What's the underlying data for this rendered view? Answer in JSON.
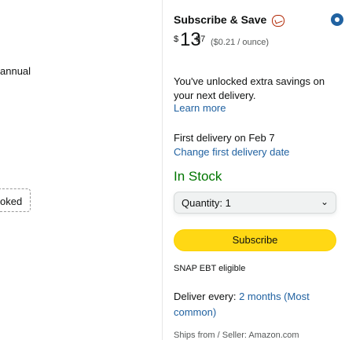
{
  "left_column": {
    "annual_text": "annual",
    "booked_text": "oked"
  },
  "subscribe": {
    "title": "Subscribe & Save",
    "badge_icon": "subscribe-save-icon",
    "radio_selected": true
  },
  "price": {
    "symbol": "$",
    "whole": "13",
    "fraction": "97",
    "per_unit": "($0.21 / ounce)"
  },
  "savings_message": "You've unlocked extra savings on your next delivery.",
  "learn_more": "Learn more",
  "first_delivery": "First delivery on Feb 7",
  "change_date": "Change first delivery date",
  "in_stock": "In Stock",
  "quantity": {
    "label": "Quantity: 1",
    "chevron_icon": "chevron-down-icon"
  },
  "subscribe_button": "Subscribe",
  "snap": "SNAP EBT eligible",
  "deliver_every": {
    "prefix": "Deliver every:",
    "value": "2 months (Most common)"
  },
  "ships_from": "Ships from / Seller: Amazon.com",
  "colors": {
    "accent_link": "#2162A1",
    "in_stock": "#007600",
    "button": "#FFD814"
  }
}
